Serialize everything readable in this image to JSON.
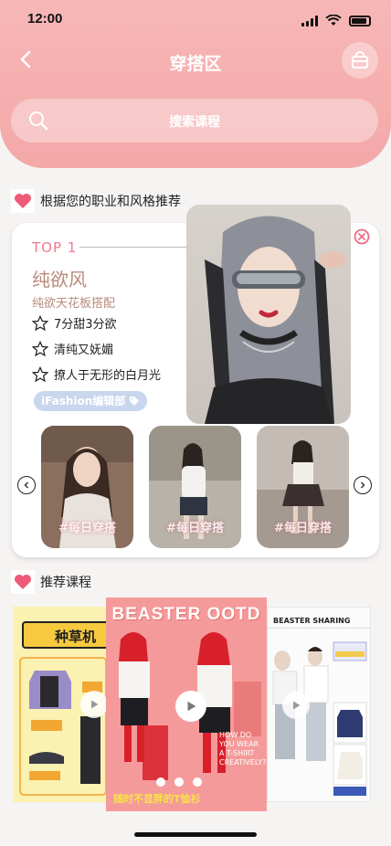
{
  "status": {
    "time": "12:00"
  },
  "header": {
    "title": "穿搭区",
    "search_placeholder": "搜索课程"
  },
  "recommend": {
    "section_title": "根据您的职业和风格推荐",
    "rank": "TOP 1",
    "style_name": "纯欲风",
    "style_sub": "纯欲天花板搭配",
    "features": [
      "7分甜3分欲",
      "清纯又妩媚",
      "撩人于无形的白月光"
    ],
    "tag": "iFashion编辑部",
    "thumbs": [
      "#每日穿搭",
      "#每日穿搭",
      "#每日穿搭"
    ]
  },
  "courses": {
    "section_title": "推荐课程",
    "poster1_title": "种草机",
    "poster2_title": "BEASTER OOTD",
    "poster2_caption": "随时不显胖的T恤衫",
    "poster2_side": "HOW DO YOU WEAR A T-SHIRT CREATIVELY?",
    "poster3_title": "BEASTER SHARING"
  },
  "colors": {
    "header": "#f4a8a8",
    "accent_pink": "#f07a8e",
    "style_brown": "#b98a7c",
    "tag_blue": "#c8d6ee"
  }
}
